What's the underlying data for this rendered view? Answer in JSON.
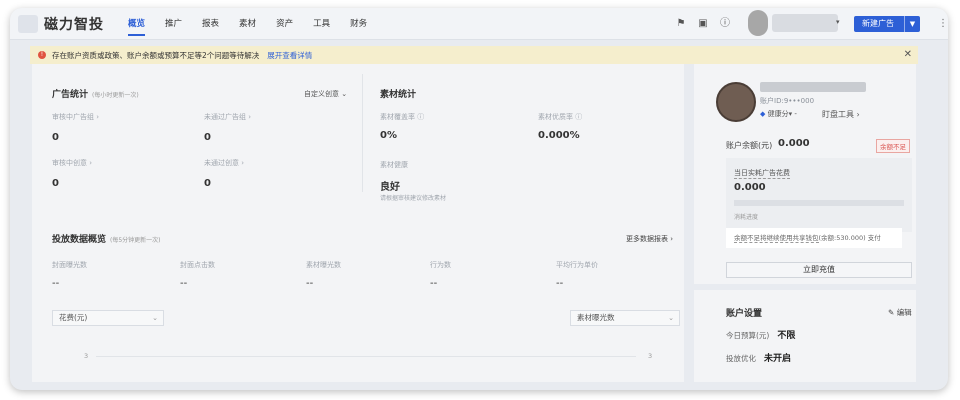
{
  "topbar": {
    "logo_text": "磁力智投",
    "nav": [
      "概览",
      "推广",
      "报表",
      "素材",
      "资产",
      "工具",
      "财务"
    ],
    "new_ad_label": "新建广告"
  },
  "alert": {
    "text": "存在账户资质或政策、账户余额或预算不足等2个问题等待解决",
    "link": "展开查看详情"
  },
  "ad_stats": {
    "title": "广告统计",
    "subtitle": "(每小时更新一次)",
    "custom_label": "自定义创意",
    "items": [
      {
        "label": "审核中广告组",
        "value": "0"
      },
      {
        "label": "未通过广告组",
        "value": "0"
      },
      {
        "label": "审核中创意",
        "value": "0"
      },
      {
        "label": "未通过创意",
        "value": "0"
      }
    ]
  },
  "material_stats": {
    "title": "素材统计",
    "items": [
      {
        "label": "素材覆盖率",
        "value": "0%"
      },
      {
        "label": "素材优质率",
        "value": "0.000%"
      }
    ],
    "health_label": "素材健康",
    "health_value": "良好",
    "health_hint": "请根据审核建议修改素材"
  },
  "delivery": {
    "title": "投放数据概览",
    "subtitle": "(每5分钟更新一次)",
    "more_link": "更多数据报表",
    "metrics": [
      {
        "label": "封面曝光数",
        "value": "--"
      },
      {
        "label": "封面点击数",
        "value": "--"
      },
      {
        "label": "素材曝光数",
        "value": "--"
      },
      {
        "label": "行为数",
        "value": "--"
      },
      {
        "label": "平均行为单价",
        "value": "--"
      }
    ],
    "left_select": "花费(元)",
    "right_select": "素材曝光数",
    "left_axis": "3",
    "right_axis": "3"
  },
  "account": {
    "id_label": "账户ID:9",
    "id_suffix": "000",
    "badge_text": "健康分",
    "badge_value": "-",
    "tool_link": "盯盘工具",
    "balance_label": "账户余额(元)",
    "balance_value": "0.000",
    "warn_tag": "余额不足",
    "daily_spend_label": "当日实耗广告花费",
    "daily_spend_value": "0.000",
    "consume_label": "消耗进度",
    "tooltip_text": "余额不足将继续使用共享钱包",
    "tooltip_extra": "(余额:530.000) 支付",
    "recharge_label": "立即充值"
  },
  "settings": {
    "title": "账户设置",
    "edit_label": "编辑",
    "rows": [
      {
        "label": "今日预算(元)",
        "value": "不限"
      },
      {
        "label": "投放优化",
        "value": "未开启"
      }
    ]
  }
}
